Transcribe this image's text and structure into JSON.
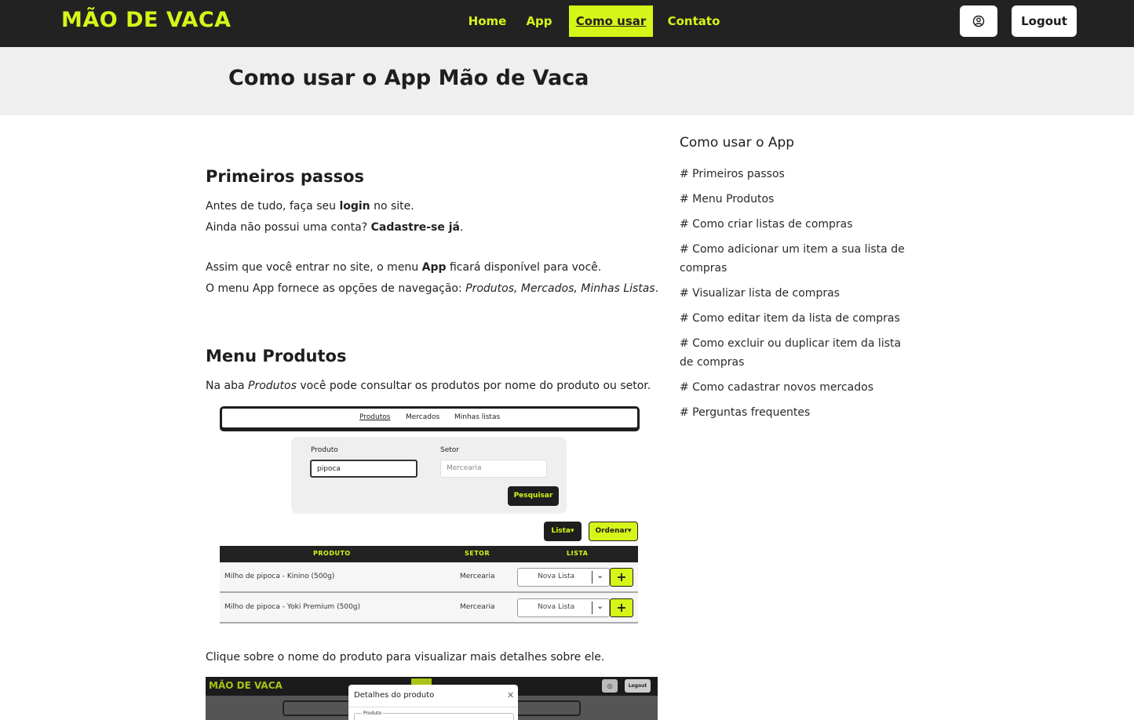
{
  "navbar": {
    "brand": "MÃO DE VACA",
    "links": [
      "Home",
      "App",
      "Como usar",
      "Contato"
    ],
    "active_link": "Como usar",
    "logout_label": "Logout",
    "user_icon": "user-circle-icon"
  },
  "header": {
    "title": "Como usar o App Mão de Vaca"
  },
  "sections": {
    "primeiros_passos": {
      "heading": "Primeiros passos",
      "p1_before": "Antes de tudo, faça seu ",
      "p1_bold": "login",
      "p1_after": " no site.",
      "p2_before": "Ainda não possui uma conta? ",
      "p2_bold": "Cadastre-se já",
      "p2_after": ".",
      "p3_before": "Assim que você entrar no site, o menu ",
      "p3_bold": "App",
      "p3_after": " ficará disponível para você.",
      "p4_before": "O menu App fornece as opções de navegação: ",
      "p4_italic": "Produtos, Mercados, Minhas Listas",
      "p4_after": "."
    },
    "menu_produtos": {
      "heading": "Menu Produtos",
      "p1_before": "Na aba ",
      "p1_italic": "Produtos",
      "p1_after": " você pode consultar os produtos por nome do produto ou setor.",
      "p2": "Clique sobre o nome do produto para visualizar mais detalhes sobre ele."
    }
  },
  "screenshot1": {
    "tabs": [
      "Produtos",
      "Mercados",
      "Minhas listas"
    ],
    "produto_label": "Produto",
    "produto_value": "pipoca",
    "setor_label": "Setor",
    "setor_placeholder": "Mercearia",
    "search_button": "Pesquisar",
    "lista_button": "Lista",
    "ordenar_button": "Ordenar",
    "table_headers": [
      "PRODUTO",
      "SETOR",
      "LISTA"
    ],
    "rows": [
      {
        "produto": "Milho de pipoca - Kinino (500g)",
        "setor": "Mercearia",
        "lista": "Nova Lista"
      },
      {
        "produto": "Milho de pipoca - Yoki Premium (500g)",
        "setor": "Mercearia",
        "lista": "Nova Lista"
      }
    ]
  },
  "screenshot2": {
    "brand": "MÃO DE VACA",
    "logout": "Logout",
    "modal_title": "Detalhes do produto",
    "field_label": "Produto"
  },
  "sidebar": {
    "title": "Como usar o App",
    "links": [
      "# Primeiros passos",
      "# Menu Produtos",
      "# Como criar listas de compras",
      "# Como adicionar um item a sua lista de compras",
      "# Visualizar lista de compras",
      "# Como editar item da lista de compras",
      "# Como excluir ou duplicar item da lista de compras",
      "# Como cadastrar novos mercados",
      "# Perguntas frequentes"
    ]
  },
  "colors": {
    "accent": "#d6f518",
    "dark": "#222222",
    "header_band": "#efefef"
  }
}
